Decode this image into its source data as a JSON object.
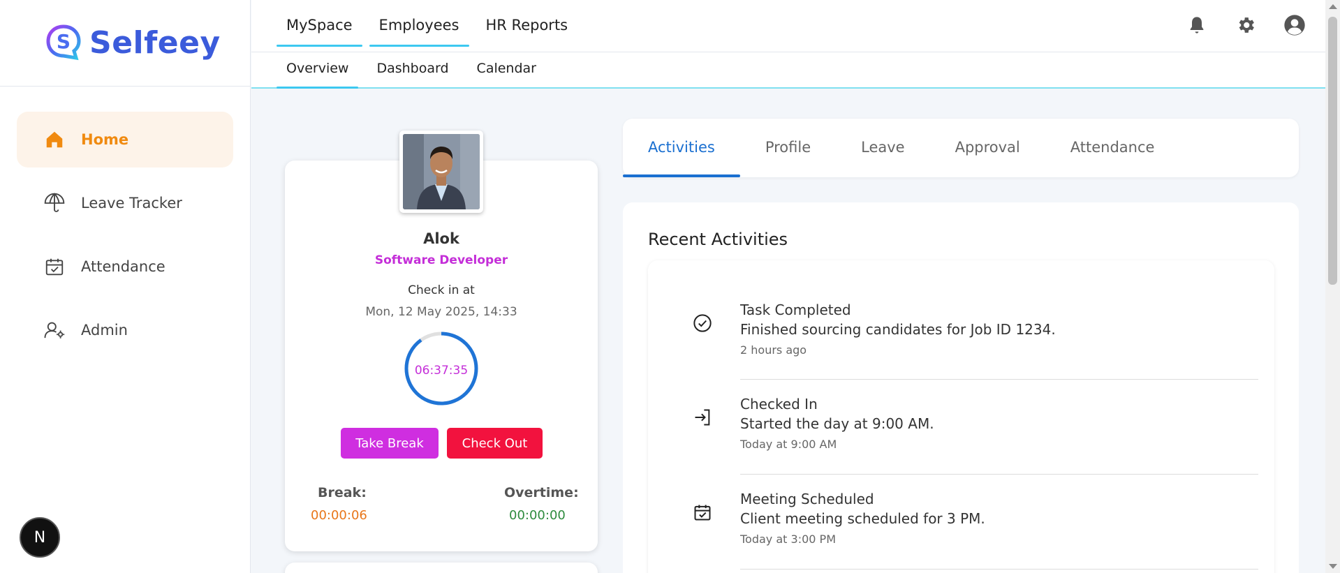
{
  "app": {
    "name": "Selfeey"
  },
  "sidebar": {
    "items": [
      {
        "label": "Home",
        "icon": "home-icon",
        "active": true
      },
      {
        "label": "Leave Tracker",
        "icon": "umbrella-icon",
        "active": false
      },
      {
        "label": "Attendance",
        "icon": "calendar-check-icon",
        "active": false
      },
      {
        "label": "Admin",
        "icon": "user-gear-icon",
        "active": false
      }
    ],
    "badge": "N"
  },
  "topnav": {
    "tabs": [
      {
        "label": "MySpace",
        "active": true
      },
      {
        "label": "Employees",
        "active": true
      },
      {
        "label": "HR Reports",
        "active": false
      }
    ],
    "icons": [
      "bell-icon",
      "gear-icon",
      "account-icon"
    ]
  },
  "subnav": {
    "tabs": [
      {
        "label": "Overview",
        "active": true
      },
      {
        "label": "Dashboard",
        "active": false
      },
      {
        "label": "Calendar",
        "active": false
      }
    ]
  },
  "profile": {
    "name": "Alok",
    "role": "Software Developer",
    "checkin_label": "Check in at",
    "checkin_time": "Mon, 12 May 2025, 14:33",
    "timer": "06:37:35",
    "timer_progress": 0.9,
    "take_break": "Take Break",
    "check_out": "Check Out",
    "break_label": "Break:",
    "break_value": "00:00:06",
    "overtime_label": "Overtime:",
    "overtime_value": "00:00:00"
  },
  "content_tabs": [
    {
      "label": "Activities",
      "active": true
    },
    {
      "label": "Profile",
      "active": false
    },
    {
      "label": "Leave",
      "active": false
    },
    {
      "label": "Approval",
      "active": false
    },
    {
      "label": "Attendance",
      "active": false
    }
  ],
  "activities": {
    "title": "Recent Activities",
    "items": [
      {
        "icon": "check-circle-icon",
        "title": "Task Completed",
        "desc": "Finished sourcing candidates for Job ID 1234.",
        "time": "2 hours ago"
      },
      {
        "icon": "login-icon",
        "title": "Checked In",
        "desc": "Started the day at 9:00 AM.",
        "time": "Today at 9:00 AM"
      },
      {
        "icon": "calendar-check-icon",
        "title": "Meeting Scheduled",
        "desc": "Client meeting scheduled for 3 PM.",
        "time": "Today at 3:00 PM"
      }
    ]
  },
  "colors": {
    "accent_orange": "#f08a10",
    "accent_magenta": "#c42ed8",
    "accent_red": "#f2123e",
    "accent_blue": "#1a6fd0",
    "brand_blue": "#3b5bdb",
    "tab_underline": "#3cc8f0"
  }
}
